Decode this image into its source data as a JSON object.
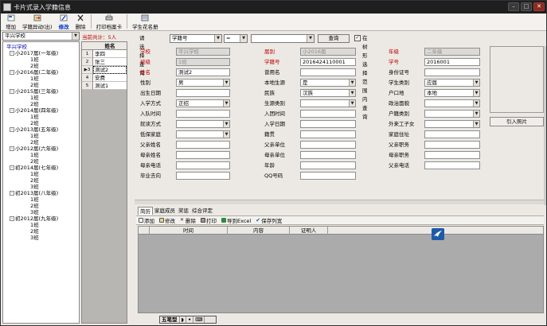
{
  "window": {
    "title": "卡片式录入学籍信息"
  },
  "toolbar": {
    "items": [
      {
        "label": "增加"
      },
      {
        "label": "学籍异动(出)"
      },
      {
        "label": "修改"
      },
      {
        "label": "删除"
      },
      {
        "label": "打印档案卡"
      },
      {
        "label": "学生花名册"
      }
    ]
  },
  "left": {
    "school_select": "平兴学校",
    "total_label": "当前共计：5人",
    "tree": [
      {
        "label": "平兴学校",
        "level": 0,
        "root": true
      },
      {
        "label": "小2017届(一年级)",
        "level": 1,
        "toggle": "-"
      },
      {
        "label": "1班",
        "level": 2
      },
      {
        "label": "2班",
        "level": 2
      },
      {
        "label": "小2016届(二年级)",
        "level": 1,
        "toggle": "-"
      },
      {
        "label": "1班",
        "level": 2
      },
      {
        "label": "2班",
        "level": 2
      },
      {
        "label": "小2015届(三年级)",
        "level": 1,
        "toggle": "-"
      },
      {
        "label": "1班",
        "level": 2
      },
      {
        "label": "2班",
        "level": 2
      },
      {
        "label": "小2014届(四年级)",
        "level": 1,
        "toggle": "-"
      },
      {
        "label": "1班",
        "level": 2
      },
      {
        "label": "2班",
        "level": 2
      },
      {
        "label": "小2013届(五年级)",
        "level": 1,
        "toggle": "-"
      },
      {
        "label": "1班",
        "level": 2
      },
      {
        "label": "2班",
        "level": 2
      },
      {
        "label": "小2012届(六年级)",
        "level": 1,
        "toggle": "-"
      },
      {
        "label": "1班",
        "level": 2
      },
      {
        "label": "2班",
        "level": 2
      },
      {
        "label": "初2014届(七年级)",
        "level": 1,
        "toggle": "-"
      },
      {
        "label": "1班",
        "level": 2
      },
      {
        "label": "2班",
        "level": 2
      },
      {
        "label": "3班",
        "level": 2
      },
      {
        "label": "初2013届(八年级)",
        "level": 1,
        "toggle": "-"
      },
      {
        "label": "1班",
        "level": 2
      },
      {
        "label": "2班",
        "level": 2
      },
      {
        "label": "3班",
        "level": 2
      },
      {
        "label": "初2012届(九年级)",
        "level": 1,
        "toggle": "-"
      },
      {
        "label": "1班",
        "level": 2
      },
      {
        "label": "2班",
        "level": 2
      },
      {
        "label": "3班",
        "level": 2
      }
    ],
    "student_list": {
      "header": "姓名",
      "rows": [
        {
          "num": "1",
          "name": "李四"
        },
        {
          "num": "2",
          "name": "张三"
        },
        {
          "num": "▶3",
          "name": "测试2",
          "selected": true
        },
        {
          "num": "4",
          "name": "安费"
        },
        {
          "num": "5",
          "name": "测试1"
        }
      ]
    }
  },
  "query": {
    "label": "请选择查询",
    "field": "学籍号",
    "operator": "=",
    "value": "",
    "button": "查询",
    "checkbox_label": "在树形选择范围内查询",
    "checked": true
  },
  "form": {
    "fields": [
      {
        "label": "学校",
        "value": "平兴学校",
        "readonly": true,
        "red": true
      },
      {
        "label": "届别",
        "value": "小2016届",
        "readonly": true,
        "red": true
      },
      {
        "label": "年级",
        "value": "二年级",
        "readonly": true,
        "red": true
      },
      {
        "label": "班级",
        "value": "1班",
        "readonly": true,
        "red": true
      },
      {
        "label": "学籍号",
        "value": "2016424110001",
        "red": true
      },
      {
        "label": "学号",
        "value": "2016001",
        "red": true
      },
      {
        "label": "姓名",
        "value": "测试2",
        "red": true
      },
      {
        "label": "曾用名",
        "value": ""
      },
      {
        "label": "身份证号",
        "value": ""
      },
      {
        "label": "性别",
        "value": "男",
        "dropdown": true
      },
      {
        "label": "本地生源",
        "value": "是",
        "dropdown": true
      },
      {
        "label": "学生类别",
        "value": "应届",
        "dropdown": true
      },
      {
        "label": "出生日期",
        "value": ""
      },
      {
        "label": "民族",
        "value": "汉族",
        "dropdown": true
      },
      {
        "label": "户口地",
        "value": "本地",
        "dropdown": true
      },
      {
        "label": "入学方式",
        "value": "正招",
        "dropdown": true
      },
      {
        "label": "生源类别",
        "value": "",
        "dropdown": true
      },
      {
        "label": "政治面貌",
        "value": "",
        "dropdown": true
      },
      {
        "label": "入队时间",
        "value": ""
      },
      {
        "label": "入团时间",
        "value": ""
      },
      {
        "label": "户籍类别",
        "value": "",
        "dropdown": true
      },
      {
        "label": "就读方式",
        "value": "",
        "dropdown": true
      },
      {
        "label": "入学日期",
        "value": ""
      },
      {
        "label": "外来工子女",
        "value": "",
        "dropdown": true
      },
      {
        "label": "低保家庭",
        "value": "",
        "dropdown": true
      },
      {
        "label": "籍贯",
        "value": ""
      },
      {
        "label": "家庭住址",
        "value": ""
      },
      {
        "label": "父亲姓名",
        "value": ""
      },
      {
        "label": "父亲单位",
        "value": ""
      },
      {
        "label": "父亲职务",
        "value": ""
      },
      {
        "label": "母亲姓名",
        "value": ""
      },
      {
        "label": "母亲单位",
        "value": ""
      },
      {
        "label": "母亲职务",
        "value": ""
      },
      {
        "label": "母亲电话",
        "value": ""
      },
      {
        "label": "年龄",
        "value": ""
      },
      {
        "label": "父亲电话",
        "value": ""
      },
      {
        "label": "毕业去向",
        "value": ""
      },
      {
        "label": "QQ号码",
        "value": ""
      }
    ]
  },
  "photo": {
    "button": "引入照片"
  },
  "tabs": [
    "简历",
    "家庭成员",
    "奖惩",
    "综合评定"
  ],
  "sub_toolbar": [
    "添加",
    "修改",
    "删除",
    "打印",
    "导到Excel",
    "保存列宽"
  ],
  "grid": {
    "columns": [
      "时间",
      "内容",
      "证明人"
    ]
  },
  "ime": {
    "cells": [
      "五笔型",
      "◗",
      "•",
      "⌨"
    ]
  },
  "colors": {
    "red_label": "#c00000",
    "selected_tab": "#0033cc",
    "title_bar": "#1f1f1f"
  }
}
